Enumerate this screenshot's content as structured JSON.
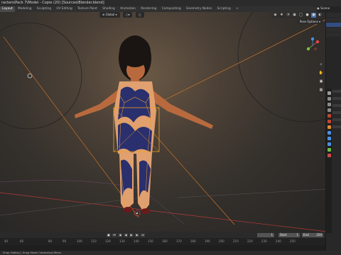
{
  "window": {
    "title": "racters\\Pack 7\\Model - Copie (20) [Sources\\Blender.blend]"
  },
  "menubar": {
    "tabs": [
      "Layout",
      "Modeling",
      "Sculpting",
      "UV Editing",
      "Texture Paint",
      "Shading",
      "Animation",
      "Rendering",
      "Compositing",
      "Geometry Nodes",
      "Scripting",
      "+"
    ],
    "active_tab": "Layout",
    "scene": "Scene"
  },
  "viewport": {
    "mode_dropdown": "Global",
    "pose_options": "Pose Options",
    "nav_icons": [
      "zoom-icon",
      "hand-icon",
      "camera-icon",
      "grid-icon"
    ]
  },
  "timeline": {
    "current_frame": "1",
    "start_label": "Start",
    "start_value": "1",
    "end_label": "End",
    "end_value": "250",
    "ruler_ticks": [
      "40",
      "60",
      "80",
      "90",
      "100",
      "110",
      "120",
      "130",
      "140",
      "150",
      "160",
      "170",
      "180",
      "190",
      "200",
      "210",
      "220",
      "230",
      "240",
      "250"
    ]
  },
  "statusbar": {
    "text": "Snap Hotkey   |   Snap Mode Contextual Menu"
  },
  "colors": {
    "accent": "#4772b3",
    "viewport_bg": "#34302c",
    "selection_orange": "#f0a020",
    "bone_line_red": "#c84040"
  }
}
